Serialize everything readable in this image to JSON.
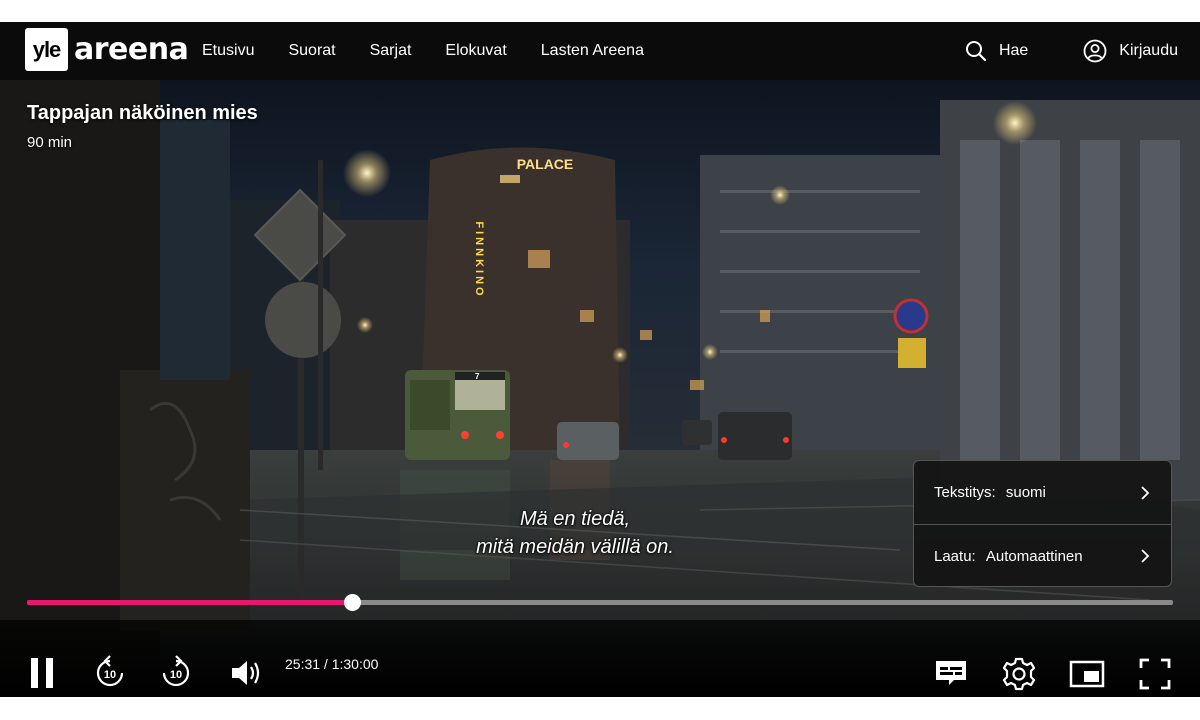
{
  "brand": {
    "logo_box": "yle",
    "logo_word": "areena"
  },
  "nav": {
    "items": [
      "Etusivu",
      "Suorat",
      "Sarjat",
      "Elokuvat",
      "Lasten Areena"
    ],
    "search_label": "Hae",
    "login_label": "Kirjaudu"
  },
  "video": {
    "title": "Tappajan näköinen mies",
    "duration": "90 min",
    "subtitle_line1": "Mä en tiedä,",
    "subtitle_line2": "mitä meidän välillä on.",
    "scene_signs": {
      "palace": "PALACE",
      "finnkino": "FINNKINO",
      "tram_number": "7"
    }
  },
  "settings_menu": {
    "subtitles_label": "Tekstitys:",
    "subtitles_value": "suomi",
    "quality_label": "Laatu:",
    "quality_value": "Automaattinen"
  },
  "player": {
    "time_display": "25:31 / 1:30:00",
    "progress_fraction": 0.2836,
    "skip_back_seconds": "10",
    "skip_forward_seconds": "10",
    "accent_color": "#e7176d",
    "icons": [
      "pause-icon",
      "rewind-10-icon",
      "forward-10-icon",
      "volume-icon",
      "subtitles-icon",
      "settings-gear-icon",
      "picture-in-picture-icon",
      "fullscreen-icon"
    ]
  }
}
